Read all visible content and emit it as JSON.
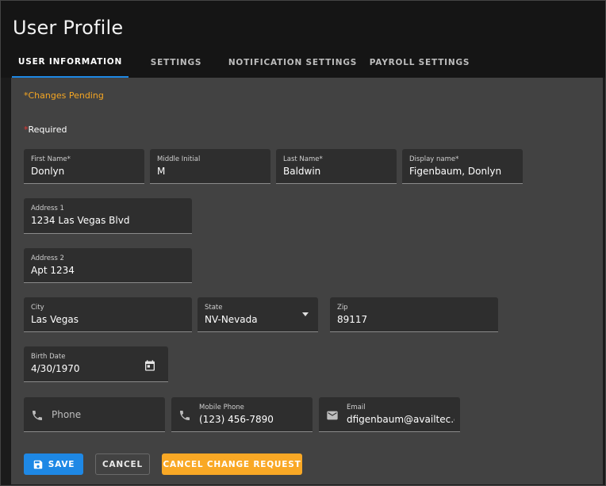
{
  "page": {
    "title": "User Profile"
  },
  "tabs": [
    {
      "label": "USER INFORMATION",
      "active": true
    },
    {
      "label": "SETTINGS",
      "active": false
    },
    {
      "label": "NOTIFICATION SETTINGS",
      "active": false
    },
    {
      "label": "PAYROLL SETTINGS",
      "active": false
    }
  ],
  "status": {
    "pending": "*Changes Pending",
    "required_star": "*",
    "required_text": "Required"
  },
  "form": {
    "first_name": {
      "label": "First Name*",
      "value": "Donlyn"
    },
    "middle_initial": {
      "label": "Middle Initial",
      "value": "M"
    },
    "last_name": {
      "label": "Last Name*",
      "value": "Baldwin"
    },
    "display_name": {
      "label": "Display name*",
      "value": "Figenbaum, Donlyn"
    },
    "address1": {
      "label": "Address 1",
      "value": "1234 Las Vegas Blvd"
    },
    "address2": {
      "label": "Address 2",
      "value": "Apt 1234"
    },
    "city": {
      "label": "City",
      "value": "Las Vegas"
    },
    "state": {
      "label": "State",
      "value": "NV-Nevada"
    },
    "zip": {
      "label": "Zip",
      "value": "89117"
    },
    "birth_date": {
      "label": "Birth Date",
      "value": "4/30/1970"
    },
    "phone": {
      "placeholder": "Phone"
    },
    "mobile_phone": {
      "label": "Mobile Phone",
      "value": "(123) 456-7890"
    },
    "email": {
      "label": "Email",
      "value": "dfigenbaum@availtec.co"
    }
  },
  "buttons": {
    "save": "SAVE",
    "cancel": "CANCEL",
    "cancel_change_request": "CANCEL CHANGE REQUEST"
  },
  "colors": {
    "accent": "#1e88e5",
    "warning": "#f5a623",
    "required": "#e53935",
    "panel": "#424242",
    "field": "#2e2e2e"
  },
  "icons": [
    "phone-icon",
    "mobile-phone-icon",
    "email-icon",
    "calendar-icon",
    "dropdown-arrow-icon",
    "save-icon"
  ]
}
